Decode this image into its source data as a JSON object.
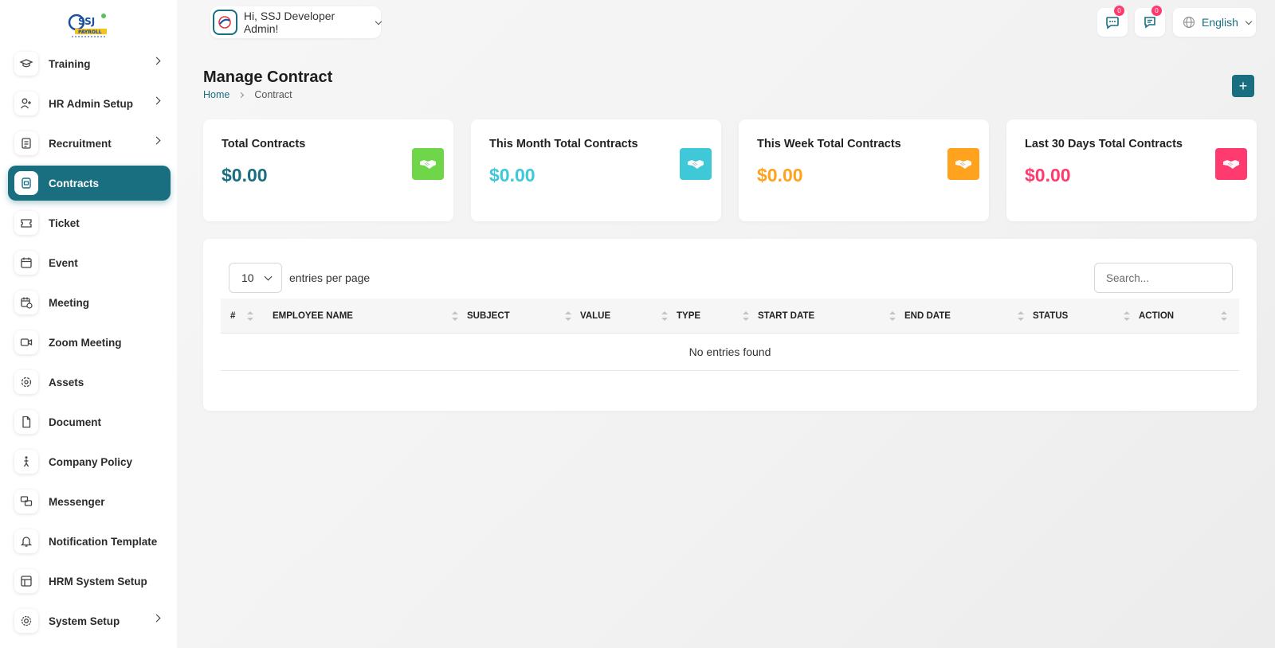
{
  "brand": {
    "logo_text": "SSJ PAYROLL"
  },
  "sidebar": {
    "items": [
      {
        "label": "Training",
        "icon": "graduation-cap-icon",
        "has_submenu": true
      },
      {
        "label": "HR Admin Setup",
        "icon": "user-plus-icon",
        "has_submenu": true
      },
      {
        "label": "Recruitment",
        "icon": "clipboard-icon",
        "has_submenu": true
      },
      {
        "label": "Contracts",
        "icon": "contract-icon",
        "has_submenu": false,
        "active": true
      },
      {
        "label": "Ticket",
        "icon": "ticket-icon",
        "has_submenu": false
      },
      {
        "label": "Event",
        "icon": "calendar-icon",
        "has_submenu": false
      },
      {
        "label": "Meeting",
        "icon": "calendar-clock-icon",
        "has_submenu": false
      },
      {
        "label": "Zoom Meeting",
        "icon": "video-icon",
        "has_submenu": false
      },
      {
        "label": "Assets",
        "icon": "puzzle-icon",
        "has_submenu": false
      },
      {
        "label": "Document",
        "icon": "file-icon",
        "has_submenu": false
      },
      {
        "label": "Company Policy",
        "icon": "walking-person-icon",
        "has_submenu": false
      },
      {
        "label": "Messenger",
        "icon": "messages-icon",
        "has_submenu": false
      },
      {
        "label": "Notification Template",
        "icon": "bell-icon",
        "has_submenu": false
      },
      {
        "label": "HRM System Setup",
        "icon": "table-icon",
        "has_submenu": false
      },
      {
        "label": "System Setup",
        "icon": "gear-icon",
        "has_submenu": true
      }
    ]
  },
  "header": {
    "greeting": "Hi, SSJ Developer Admin!",
    "chat_badge": "0",
    "message_badge": "0",
    "language": "English"
  },
  "page": {
    "title": "Manage Contract",
    "breadcrumb_home": "Home",
    "breadcrumb_current": "Contract",
    "add_label": "+"
  },
  "cards": [
    {
      "title": "Total Contracts",
      "value": "$0.00",
      "color": "#196f80",
      "icon_bg": "#6fd64a"
    },
    {
      "title": "This Month Total Contracts",
      "value": "$0.00",
      "color": "#3ec8d8",
      "icon_bg": "#3ec8d8"
    },
    {
      "title": "This Week Total Contracts",
      "value": "$0.00",
      "color": "#ffa21d",
      "icon_bg": "#ffa21d"
    },
    {
      "title": "Last 30 Days Total Contracts",
      "value": "$0.00",
      "color": "#ff3a6e",
      "icon_bg": "#ff3a6e"
    }
  ],
  "table": {
    "per_page_value": "10",
    "per_page_label": "entries per page",
    "search_placeholder": "Search...",
    "columns": [
      "#",
      "EMPLOYEE NAME",
      "SUBJECT",
      "VALUE",
      "TYPE",
      "START DATE",
      "END DATE",
      "STATUS",
      "ACTION"
    ],
    "empty_message": "No entries found"
  }
}
